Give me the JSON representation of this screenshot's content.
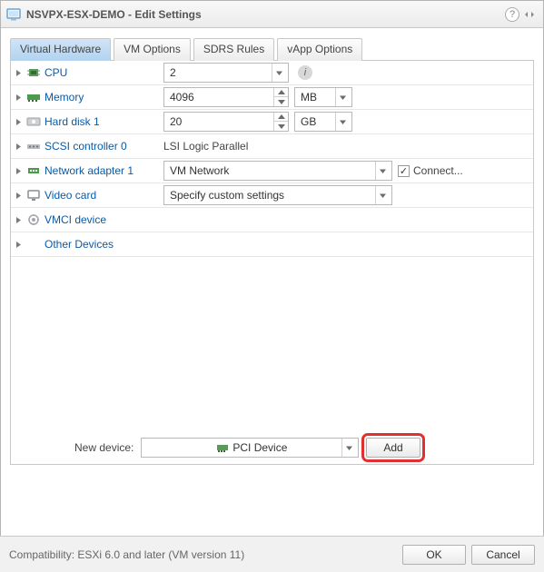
{
  "titlebar": {
    "title": "NSVPX-ESX-DEMO - Edit Settings"
  },
  "tabs": {
    "t0": "Virtual Hardware",
    "t1": "VM Options",
    "t2": "SDRS Rules",
    "t3": "vApp Options"
  },
  "rows": {
    "cpu": {
      "label": "CPU",
      "value": "2"
    },
    "memory": {
      "label": "Memory",
      "value": "4096",
      "unit": "MB"
    },
    "disk": {
      "label": "Hard disk 1",
      "value": "20",
      "unit": "GB"
    },
    "scsi": {
      "label": "SCSI controller 0",
      "value": "LSI Logic Parallel"
    },
    "net": {
      "label": "Network adapter 1",
      "value": "VM Network",
      "connect": "Connect..."
    },
    "video": {
      "label": "Video card",
      "value": "Specify custom settings"
    },
    "vmci": {
      "label": "VMCI device"
    },
    "other": {
      "label": "Other Devices"
    }
  },
  "newdev": {
    "label": "New device:",
    "value": "PCI Device",
    "add": "Add"
  },
  "footer": {
    "compat": "Compatibility: ESXi 6.0 and later (VM version 11)",
    "ok": "OK",
    "cancel": "Cancel"
  }
}
